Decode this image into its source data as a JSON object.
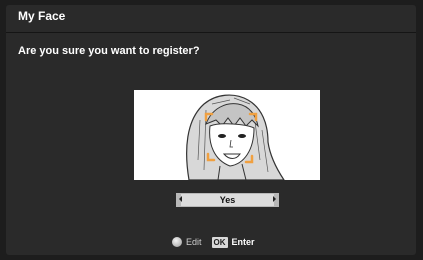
{
  "screen": {
    "title": "My Face",
    "question": "Are you sure you want to register?"
  },
  "photo": {
    "subject": "face-sketch-with-detection-markers",
    "marker_color": "#f0a040"
  },
  "selector": {
    "value": "Yes"
  },
  "hints": {
    "edit_icon": "dpad-icon",
    "edit_label": "Edit",
    "ok_key": "OK",
    "enter_label": "Enter"
  }
}
